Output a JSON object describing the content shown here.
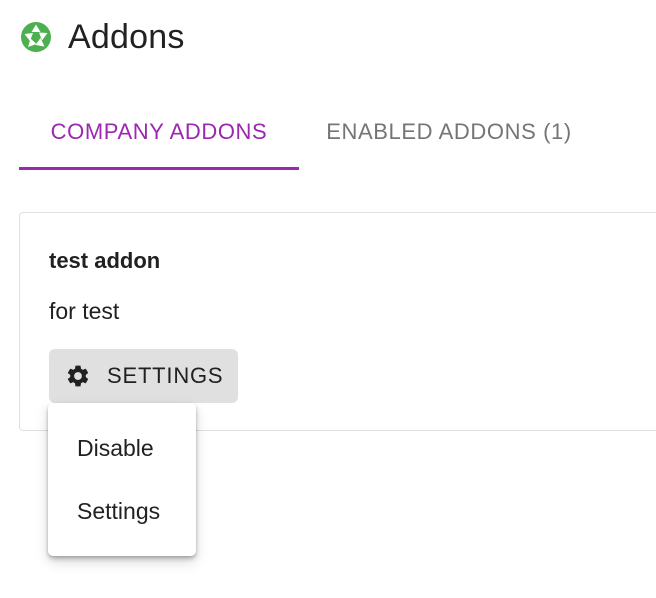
{
  "colors": {
    "accent": "#9c27b0",
    "inactive_tab": "#757575",
    "logo": "#4caf50",
    "button_bg": "#e0e0e0"
  },
  "header": {
    "title": "Addons",
    "logo_icon": "aperture-icon"
  },
  "tabs": [
    {
      "label": "COMPANY ADDONS",
      "active": true
    },
    {
      "label": "ENABLED ADDONS (1)",
      "active": false
    }
  ],
  "addon_card": {
    "title": "test addon",
    "description": "for test",
    "settings_button": {
      "label": "SETTINGS",
      "icon": "gear-icon"
    }
  },
  "menu": {
    "items": [
      {
        "label": "Disable"
      },
      {
        "label": "Settings"
      }
    ]
  }
}
